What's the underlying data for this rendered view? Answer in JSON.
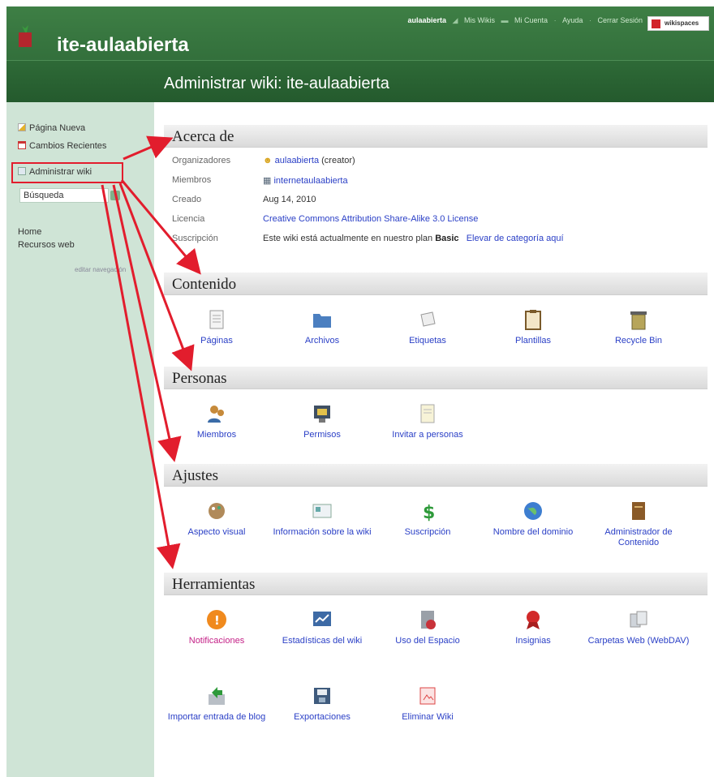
{
  "header": {
    "site_name": "ite-aulaabierta",
    "admin_title": "Administrar wiki: ite-aulaabierta",
    "user": "aulaabierta",
    "my_wikis": "Mis Wikis",
    "my_account": "Mi Cuenta",
    "help": "Ayuda",
    "logout": "Cerrar Sesión",
    "badge": "wikispaces"
  },
  "sidebar": {
    "new_page": "Página Nueva",
    "recent_changes": "Cambios Recientes",
    "manage_wiki": "Administrar wiki",
    "search_placeholder": "Búsqueda",
    "home": "Home",
    "web_resources": "Recursos web",
    "edit_navigation": "editar navegación"
  },
  "about": {
    "heading": "Acerca de",
    "organizers_label": "Organizadores",
    "organizer_name": "aulaabierta",
    "organizer_role": "(creator)",
    "members_label": "Miembros",
    "member_name": "internetaulaabierta",
    "created_label": "Creado",
    "created_value": "Aug 14, 2010",
    "license_label": "Licencia",
    "license_value": "Creative Commons Attribution Share-Alike 3.0 License",
    "subscription_label": "Suscripción",
    "subscription_text": "Este wiki está actualmente en nuestro plan",
    "subscription_plan": "Basic",
    "upgrade_link": "Elevar de categoría aquí"
  },
  "sections": {
    "content": "Contenido",
    "people": "Personas",
    "settings": "Ajustes",
    "tools": "Herramientas"
  },
  "content_items": [
    "Páginas",
    "Archivos",
    "Etiquetas",
    "Plantillas",
    "Recycle Bin"
  ],
  "people_items": [
    "Miembros",
    "Permisos",
    "Invitar a personas"
  ],
  "settings_items": [
    "Aspecto visual",
    "Información sobre la wiki",
    "Suscripción",
    "Nombre del dominio",
    "Administrador de Contenido"
  ],
  "tools_items": [
    "Notificaciones",
    "Estadísticas del wiki",
    "Uso del Espacio",
    "Insignias",
    "Carpetas Web (WebDAV)",
    "Importar entrada de blog",
    "Exportaciones",
    "Eliminar Wiki"
  ],
  "colors": {
    "header_green": "#2e6a37",
    "sidebar_green": "#cfe4d6",
    "link_blue": "#2a3fc6",
    "annotation_red": "#e21d2d",
    "notification_pink": "#c41f86"
  }
}
